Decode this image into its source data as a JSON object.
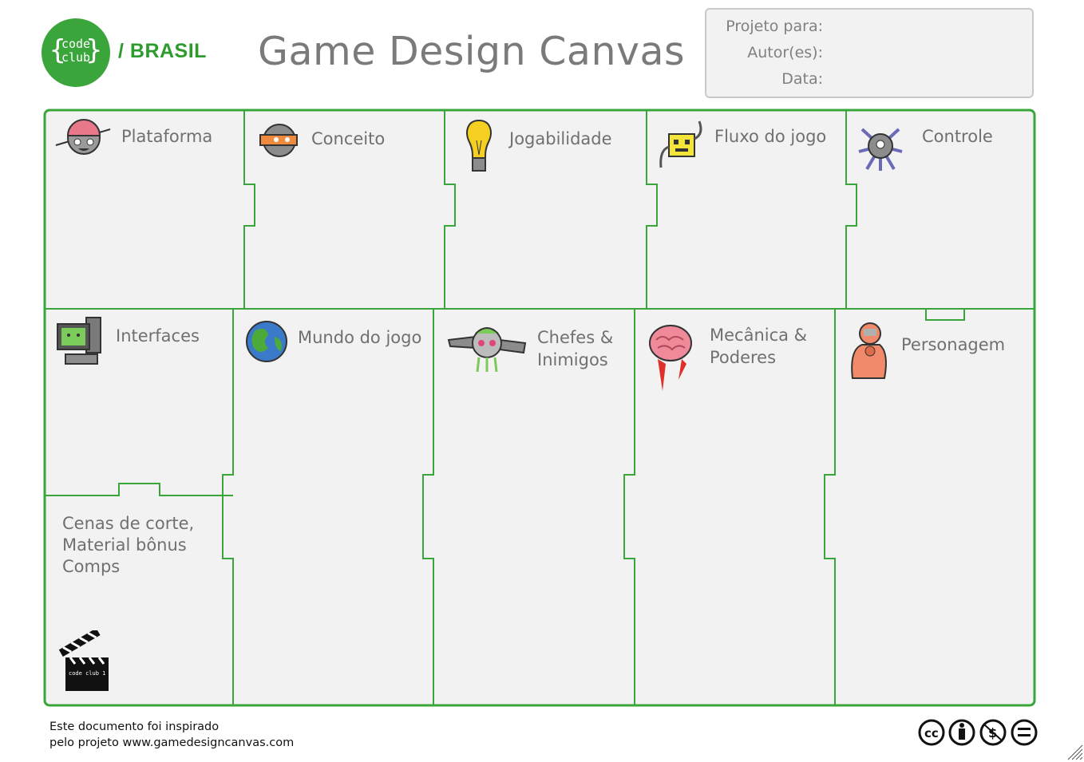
{
  "header": {
    "logo_line1": "code",
    "logo_line2": "club",
    "brand": "/ BRASIL",
    "title": "Game Design Canvas"
  },
  "meta_fields": {
    "project": "Projeto para:",
    "authors": "Autor(es):",
    "date": "Data:"
  },
  "cells": {
    "plataforma": "Plataforma",
    "conceito": "Conceito",
    "jogabilidade": "Jogabilidade",
    "fluxo": "Fluxo do jogo",
    "controle": "Controle",
    "interfaces": "Interfaces",
    "mundo": "Mundo do jogo",
    "chefes_1": "Chefes &",
    "chefes_2": "Inimigos",
    "mecanica_1": "Mecânica &",
    "mecanica_2": "Poderes",
    "personagem": "Personagem",
    "cenas_1": "Cenas de corte,",
    "cenas_2": "Material bônus",
    "cenas_3": "Comps",
    "clapper_text": "code club 1"
  },
  "footer": {
    "line1": "Este documento foi inspirado",
    "line2_prefix": "pelo projeto ",
    "line2_link": "www.gamedesigncanvas.com"
  },
  "license_icons": [
    "cc-icon",
    "attribution-icon",
    "noncommercial-icon",
    "no-derivatives-icon"
  ],
  "colors": {
    "green": "#3aa53a",
    "canvas_bg": "#f2f2f2",
    "label_gray": "#707070"
  }
}
